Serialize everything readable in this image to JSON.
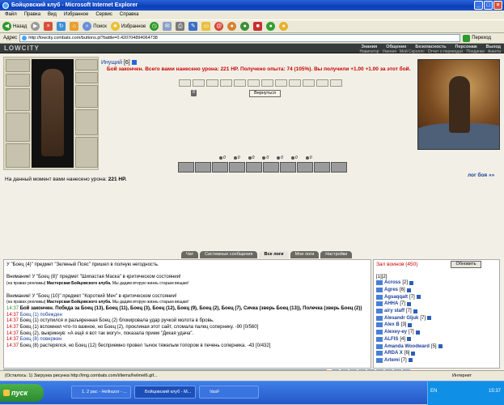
{
  "window": {
    "title": "Бойцовский клуб - Microsoft Internet Explorer"
  },
  "menu": [
    "Файл",
    "Правка",
    "Вид",
    "Избранное",
    "Сервис",
    "Справка"
  ],
  "toolbar": {
    "back": "Назад",
    "search": "Поиск",
    "favorites": "Избранное"
  },
  "address": {
    "label": "Адрес",
    "url": "http://lowcity.combats.com/buttons.pl?battle=0.420704894064738",
    "go": "Переход"
  },
  "site": {
    "logo": "LOWCITY",
    "nav_top": [
      "Знания",
      "Общение",
      "Безопасность",
      "Персонаж",
      "Выход"
    ],
    "nav_bottom": [
      "Навигатор",
      "Умения",
      "Мой Скроллс",
      "Отчет о переводах",
      "Поединки",
      "Анкета"
    ]
  },
  "character": {
    "name": "Инущий",
    "level": "[6]"
  },
  "battle": {
    "result": "Бой закончен. Всего вами нанесено урона: 221 HP. Получено опыта: 74 (105%). Вы получили +1.00 +1.00 за этот бой.",
    "return_button": "Вернуться",
    "flag": "8"
  },
  "counters": [
    "0",
    "0",
    "0",
    "0",
    "0",
    "0",
    "0"
  ],
  "damage": {
    "label": "На данный момент вами нанесено урона:",
    "value": "221 HP."
  },
  "log_link": "лог боя »»",
  "tabs": [
    "Чат",
    "Системные сообщения",
    "Все логи",
    "Мои логи",
    "Настройки"
  ],
  "chat": [
    {
      "text": "У \"Боец (4)\" предмет \"Зеленый Пояс\" пришел в полную негодность."
    },
    {
      "text": ""
    },
    {
      "text": "Внимание! У \"Боец (8)\" предмет \"Шипастая Маска\" в критическом состоянии!"
    },
    {
      "ad": "(на правах рекламы)",
      "adbold": "Мастерская Бойцовского клуба.",
      "adtail": "Мы дадим вторую жизнь старым вещам!"
    },
    {
      "text": ""
    },
    {
      "text": "Внимание! У \"Боец (10)\" предмет \"Короткий Меч\" в критическом состоянии!"
    },
    {
      "ad": "(на правах рекламы)",
      "adbold": "Мастерская Бойцовского клуба.",
      "adtail": "Мы дадим вторую жизнь старым вещам!"
    },
    {
      "time": "14:37",
      "text": "Бой закончен. Победа за Боец (13), Боец (11), Боец (3), Боец (12), Боец (9), Боец (2), Боец (7), Сичка (зверь Боец (13)), Полечка (зверь Боец (2))"
    },
    {
      "time": "14:37",
      "text": "Боец (1) побежден"
    },
    {
      "time": "14:37",
      "text": "Боец (1) оступился и разъяренная Боец (2) блокировала удар ручкой молота в бровь."
    },
    {
      "time": "14:37",
      "text": "Боец (1) вспомнил что-то важное, но Боец (2), проклиная этот сайт, сломала палец сопернику. -90 [0/560]"
    },
    {
      "time": "14:37",
      "text": "Боец (2), выкрикнув: «А ещё я вот так могу!», показала прием \"Дикая удача\"."
    },
    {
      "time": "14:37",
      "text": "Боец (8) повержен"
    },
    {
      "time": "14:37",
      "text": "Боец (8) растерялся, но Боец (12) бесприемно провел тычок тяжелым топором в печень соперника. -43 [0/432]"
    }
  ],
  "hall": {
    "title": "Зал воинов (450)",
    "refresh": "Обновить",
    "pages": "[1][2]",
    "users": [
      {
        "name": "Across",
        "level": "[2]"
      },
      {
        "name": "Agres",
        "level": "[6]"
      },
      {
        "name": "Agsaqqalt",
        "level": "[7]"
      },
      {
        "name": "AHHA",
        "level": "[7]"
      },
      {
        "name": "airy staff",
        "level": "[7]"
      },
      {
        "name": "Alesandr Gljuk",
        "level": "[7]"
      },
      {
        "name": "Alex B",
        "level": "[3]"
      },
      {
        "name": "Alexey-ey",
        "level": "[7]"
      },
      {
        "name": "ALFIS",
        "level": "[4]"
      },
      {
        "name": "Amanda Woodward",
        "level": "[5]"
      },
      {
        "name": "ARDA X",
        "level": "[6]"
      },
      {
        "name": "Artemi",
        "level": "[7]"
      }
    ]
  },
  "status": {
    "text": "(Осталось: 1) Загрузка рисунка http://img.combats.com/i/items/helmet6.gif...",
    "zone": "Интернет"
  },
  "taskbar": {
    "start": "пуск",
    "tasks": [
      "1. 2 рас - Hellrazor - ...",
      "Бойцовский клуб - M...",
      "VasF"
    ],
    "lang": "EN",
    "clock": "15:37"
  },
  "colors": {
    "titlebar": "#0a3fb8",
    "taskbar": "#2458c8",
    "alert": "#cc0000",
    "link": "#1b3f9a"
  }
}
